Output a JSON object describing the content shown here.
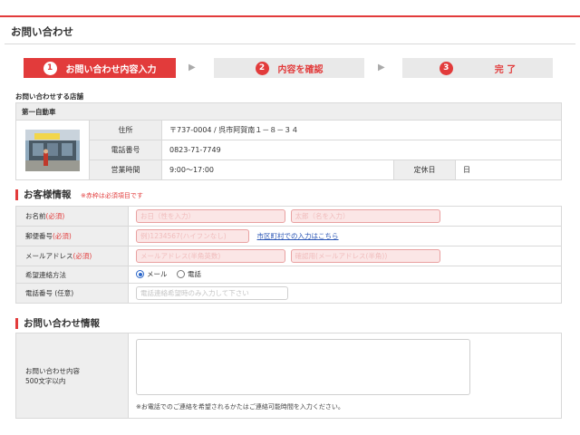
{
  "page": {
    "title": "お問い合わせ"
  },
  "steps": [
    {
      "num": "1",
      "label": "お問い合わせ内容入力"
    },
    {
      "num": "2",
      "label": "内容を確認"
    },
    {
      "num": "3",
      "label": "完 了"
    }
  ],
  "step_arrow": "▶",
  "shop": {
    "heading": "お問い合わせする店舗",
    "name": "第一自動車",
    "address_label": "住所",
    "address": "〒737-0004 / 呉市阿賀南１－８－３４",
    "phone_label": "電話番号",
    "phone": "0823-71-7749",
    "hours_label": "営業時間",
    "hours": "9:00～17:00",
    "holiday_label": "定休日",
    "holiday": "日"
  },
  "customer": {
    "heading": "お客様情報",
    "note": "※赤枠は必須項目です",
    "name_label": "お名前",
    "required_mark": "(必須)",
    "name_last_placeholder": "お日（性を入力）",
    "name_first_placeholder": "太郎（名を入力）",
    "zip_label": "郵便番号",
    "zip_placeholder": "例)1234567(ハイフンなし)",
    "zip_link": "市区町村での入力はこちら",
    "email_label": "メールアドレス",
    "email_placeholder": "メールアドレス(半角英数)",
    "email_confirm_placeholder": "確認用(メールアドレス(半角))",
    "contact_method_label": "希望連絡方法",
    "contact_options": [
      "メール",
      "電話"
    ],
    "contact_selected": "メール",
    "tel_label": "電話番号 (任意)",
    "tel_placeholder": "電話連絡希望時のみ入力して下さい"
  },
  "inquiry": {
    "heading": "お問い合わせ情報",
    "label_line1": "お問い合わせ内容",
    "label_line2": "500文字以内",
    "hint": "※お電話でのご連絡を希望されるかたはご連絡可能時間を入力ください。"
  },
  "colors": {
    "accent": "#e23b3b",
    "link": "#2a55b5"
  }
}
